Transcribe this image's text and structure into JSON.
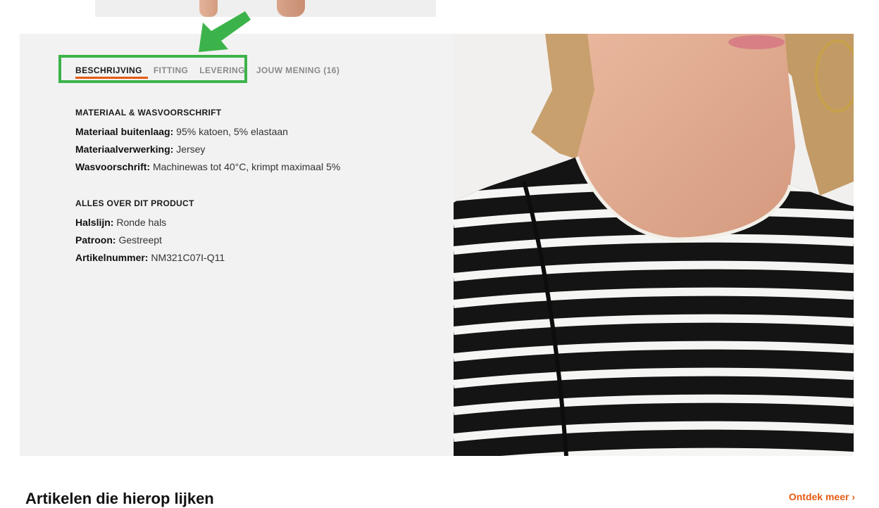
{
  "tabs": [
    {
      "label": "BESCHRIJVING",
      "active": true
    },
    {
      "label": "FITTING",
      "active": false
    },
    {
      "label": "LEVERING",
      "active": false
    },
    {
      "label": "JOUW MENING (16)",
      "active": false
    }
  ],
  "sections": {
    "material": {
      "title": "MATERIAAL & WASVOORSCHRIFT",
      "items": [
        {
          "label": "Materiaal buitenlaag:",
          "value": "95% katoen, 5% elastaan"
        },
        {
          "label": "Materiaalverwerking:",
          "value": "Jersey"
        },
        {
          "label": "Wasvoorschrift:",
          "value": "Machinewas tot 40°C, krimpt maximaal 5%"
        }
      ]
    },
    "product": {
      "title": "ALLES OVER DIT PRODUCT",
      "items": [
        {
          "label": "Halslijn:",
          "value": "Ronde hals"
        },
        {
          "label": "Patroon:",
          "value": "Gestreept"
        },
        {
          "label": "Artikelnummer:",
          "value": "NM321C07I-Q11"
        }
      ]
    }
  },
  "bottom": {
    "title": "Artikelen die hierop lijken",
    "link": "Ontdek meer"
  },
  "colors": {
    "accent": "#e55b13",
    "highlight": "#3cb34a",
    "panel_bg": "#f2f2f2"
  }
}
